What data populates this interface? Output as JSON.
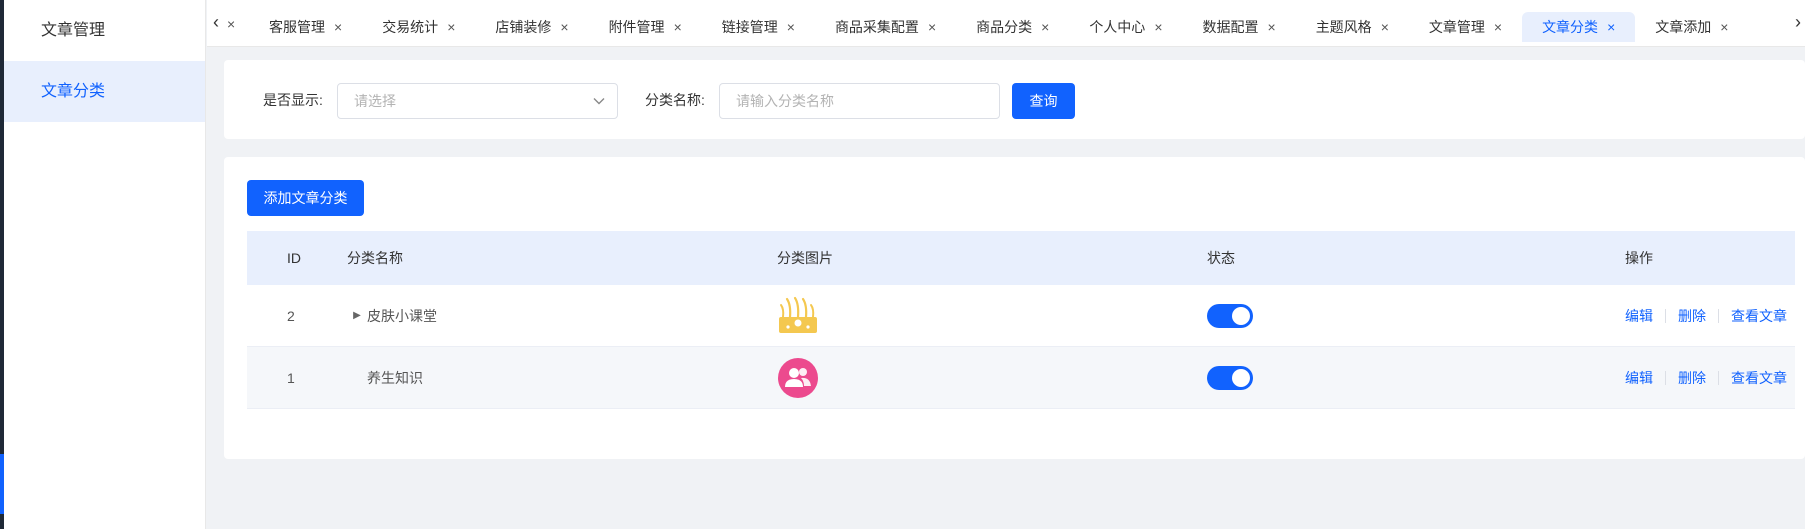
{
  "sidebar": {
    "items": [
      {
        "label": "文章管理",
        "active": false
      },
      {
        "label": "文章分类",
        "active": true
      }
    ]
  },
  "tabs": {
    "items": [
      {
        "label": "客服管理"
      },
      {
        "label": "交易统计"
      },
      {
        "label": "店铺装修"
      },
      {
        "label": "附件管理"
      },
      {
        "label": "链接管理"
      },
      {
        "label": "商品采集配置"
      },
      {
        "label": "商品分类"
      },
      {
        "label": "个人中心"
      },
      {
        "label": "数据配置"
      },
      {
        "label": "主题风格"
      },
      {
        "label": "文章管理"
      },
      {
        "label": "文章分类",
        "active": true
      },
      {
        "label": "文章添加"
      }
    ],
    "close_glyph": "×",
    "prev_icon": "chevron-left-icon",
    "next_icon": "chevron-right-icon"
  },
  "filter": {
    "show_label": "是否显示:",
    "show_placeholder": "请选择",
    "name_label": "分类名称:",
    "name_placeholder": "请输入分类名称",
    "query_label": "查询"
  },
  "toolbar": {
    "add_label": "添加文章分类"
  },
  "table": {
    "columns": {
      "id": "ID",
      "name": "分类名称",
      "image": "分类图片",
      "status": "状态",
      "ops": "操作"
    },
    "rows": [
      {
        "id": "2",
        "name": "皮肤小课堂",
        "expandable": true,
        "image_icon": "skin-hair-icon",
        "status_on": true
      },
      {
        "id": "1",
        "name": "养生知识",
        "expandable": false,
        "image_icon": "users-circle-icon",
        "status_on": true
      }
    ],
    "ops": {
      "edit": "编辑",
      "delete": "删除",
      "view": "查看文章"
    }
  },
  "colors": {
    "primary": "#1162fe",
    "active_bg": "#e8effd",
    "skin_icon": "#f4c850",
    "user_icon": "#ec4a8e"
  }
}
